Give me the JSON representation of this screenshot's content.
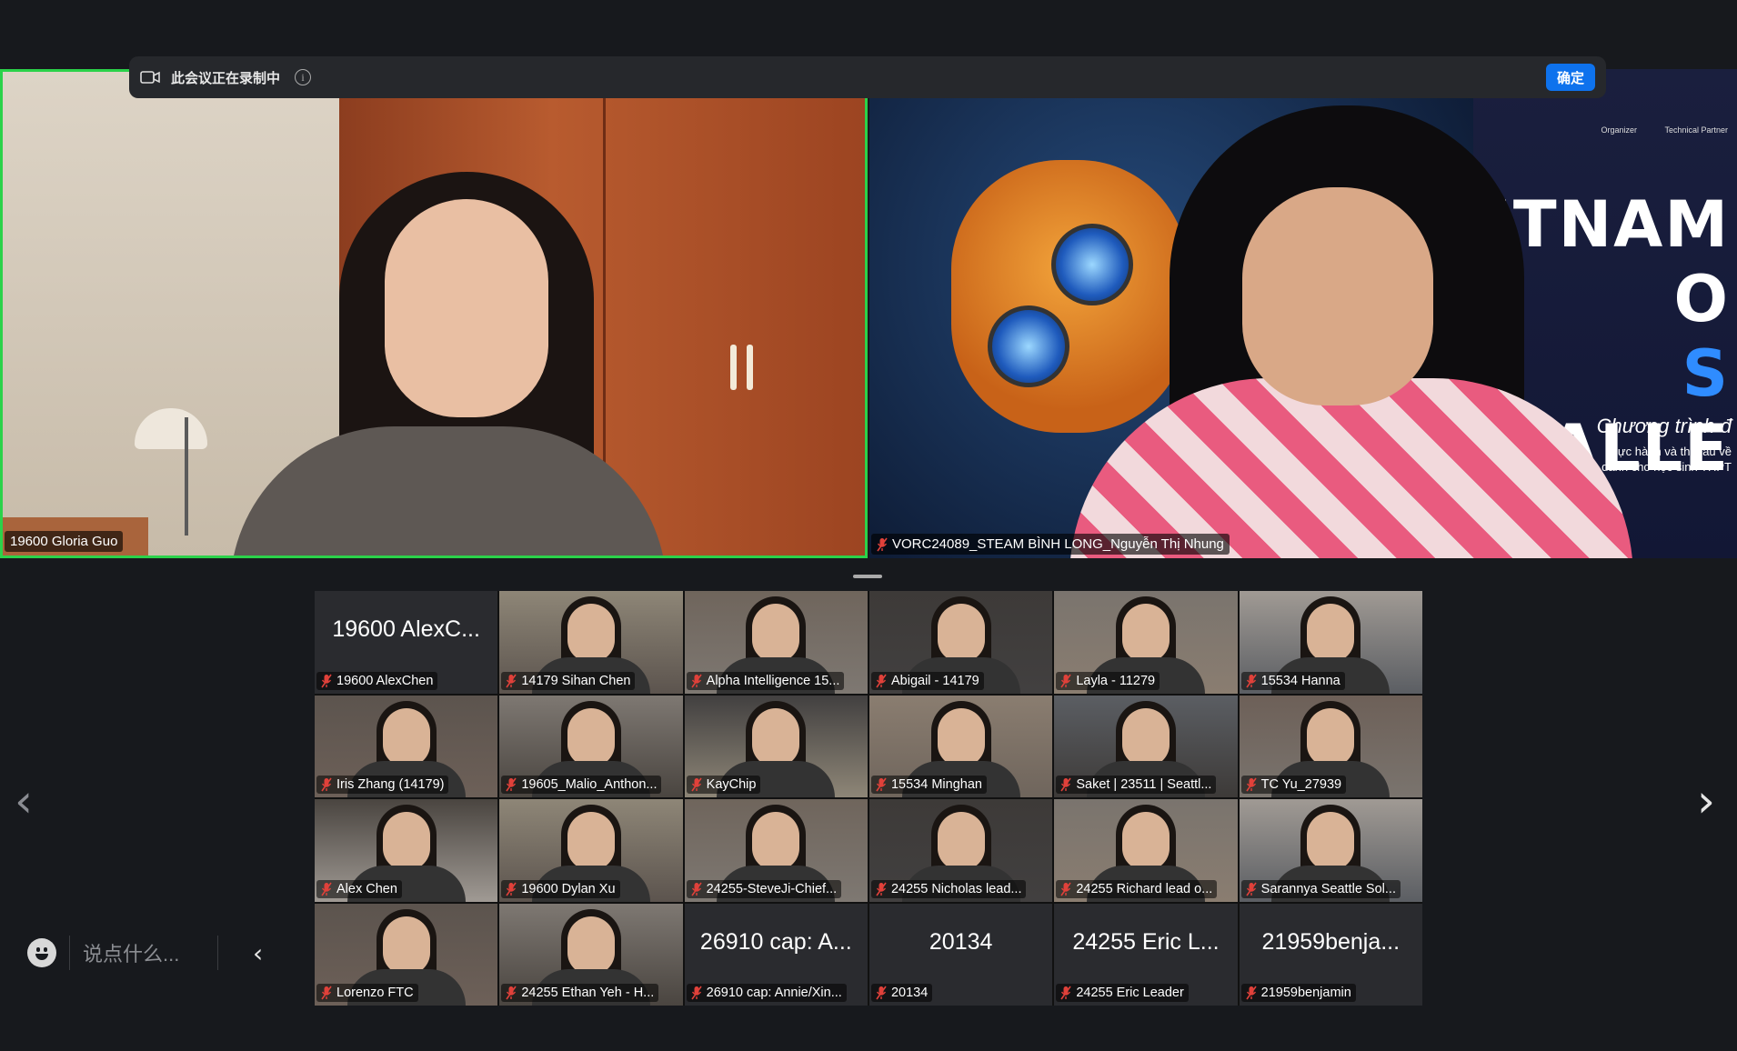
{
  "recording_banner": {
    "text": "此会议正在录制中",
    "confirm_label": "确定",
    "info_glyph": "i"
  },
  "speakers": [
    {
      "name": "19600 Gloria Guo",
      "active": true,
      "muted": false
    },
    {
      "name": "VORC24089_STEAM BÌNH LONG_Nguyễn Thị Nhung",
      "active": false,
      "muted": true
    }
  ],
  "background_banner": {
    "organizer": "Organizer",
    "technical_partner": "Technical Partner",
    "title_line1": "IETNAM O",
    "title_line2_blue": "S",
    "title_line2": " CHALLE",
    "subtitle": "Chương trình đ",
    "subtitle2_line1": "thực hành và thi đấu về",
    "subtitle2_line2": "dành cho học sinh THPT"
  },
  "gallery": [
    {
      "label": "19600 AlexChen",
      "big": "19600 AlexC...",
      "video": false
    },
    {
      "label": "14179 Sihan Chen",
      "video": true
    },
    {
      "label": "Alpha Intelligence 15...",
      "video": true
    },
    {
      "label": "Abigail - 14179",
      "video": true
    },
    {
      "label": "Layla - 11279",
      "video": true
    },
    {
      "label": "15534 Hanna",
      "video": true
    },
    {
      "label": "Iris Zhang (14179)",
      "video": true
    },
    {
      "label": "19605_Malio_Anthon...",
      "video": true
    },
    {
      "label": "KayChip",
      "video": true
    },
    {
      "label": "15534 Minghan",
      "video": true
    },
    {
      "label": "Saket | 23511 | Seattl...",
      "video": true
    },
    {
      "label": "TC Yu_27939",
      "video": true
    },
    {
      "label": "Alex Chen",
      "video": true
    },
    {
      "label": "19600 Dylan Xu",
      "video": true
    },
    {
      "label": "24255-SteveJi-Chief...",
      "video": true
    },
    {
      "label": "24255 Nicholas lead...",
      "video": true
    },
    {
      "label": "24255 Richard lead o...",
      "video": true
    },
    {
      "label": "Sarannya Seattle Sol...",
      "video": true
    },
    {
      "label": "Lorenzo FTC",
      "video": true
    },
    {
      "label": "24255 Ethan Yeh - H...",
      "video": true
    },
    {
      "label": "26910 cap: Annie/Xin...",
      "big": "26910 cap: A...",
      "video": false
    },
    {
      "label": "20134",
      "big": "20134",
      "video": false
    },
    {
      "label": "24255 Eric Leader",
      "big": "24255 Eric L...",
      "video": false
    },
    {
      "label": "21959benjamin",
      "big": "21959benja...",
      "video": false
    }
  ],
  "nav": {
    "prev": "‹",
    "next": "›"
  },
  "chat": {
    "placeholder": "说点什么...",
    "collapse_glyph": "‹"
  },
  "colors": {
    "accent": "#0e72ed",
    "active_speaker": "#2bd24a",
    "muted_mic": "#e0413a"
  }
}
